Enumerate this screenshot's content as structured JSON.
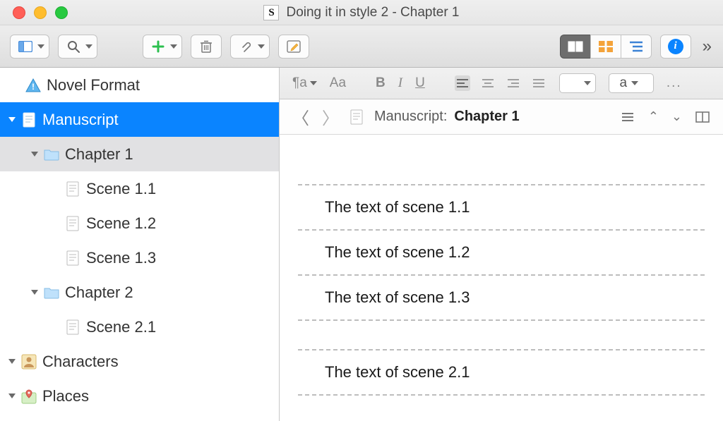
{
  "window": {
    "title": "Doing it in style 2 - Chapter 1"
  },
  "toolbar": {
    "icons": {
      "layout": "layout-icon",
      "search": "search-icon",
      "add": "plus-icon",
      "trash": "trash-icon",
      "attach": "paperclip-icon",
      "compose": "compose-icon",
      "view_scrivenings": "scrivenings-icon",
      "view_corkboard": "corkboard-icon",
      "view_outline": "outline-icon",
      "info": "info-icon",
      "more": "more-icon"
    }
  },
  "binder": {
    "items": [
      {
        "label": "Novel Format",
        "icon": "template-info-icon",
        "depth": 0,
        "disclosure": "down",
        "selected": false
      },
      {
        "label": "Manuscript",
        "icon": "manuscript-icon",
        "depth": 0,
        "disclosure": "down",
        "selected": true
      },
      {
        "label": "Chapter 1",
        "icon": "folder-icon",
        "depth": 1,
        "disclosure": "down",
        "subselected": true
      },
      {
        "label": "Scene 1.1",
        "icon": "text-doc-icon",
        "depth": 2
      },
      {
        "label": "Scene 1.2",
        "icon": "text-doc-icon",
        "depth": 2
      },
      {
        "label": "Scene 1.3",
        "icon": "text-doc-icon",
        "depth": 2
      },
      {
        "label": "Chapter 2",
        "icon": "folder-icon",
        "depth": 1,
        "disclosure": "down"
      },
      {
        "label": "Scene 2.1",
        "icon": "text-doc-icon",
        "depth": 2
      },
      {
        "label": "Characters",
        "icon": "character-icon",
        "depth": 0,
        "disclosure": "down"
      },
      {
        "label": "Places",
        "icon": "places-icon",
        "depth": 0,
        "disclosure": "down"
      }
    ]
  },
  "format_bar": {
    "para": "¶a",
    "caps": "Aa",
    "bold": "B",
    "italic": "I",
    "underline": "U",
    "line_spacing_label": "a",
    "ellipsis": "..."
  },
  "path_bar": {
    "context": "Manuscript:",
    "title": "Chapter 1"
  },
  "scenes": [
    {
      "text": "The text of scene 1.1"
    },
    {
      "text": "The text of scene 1.2"
    },
    {
      "text": "The text of scene 1.3"
    }
  ],
  "scenes_next": [
    {
      "text": "The text of scene 2.1"
    }
  ]
}
